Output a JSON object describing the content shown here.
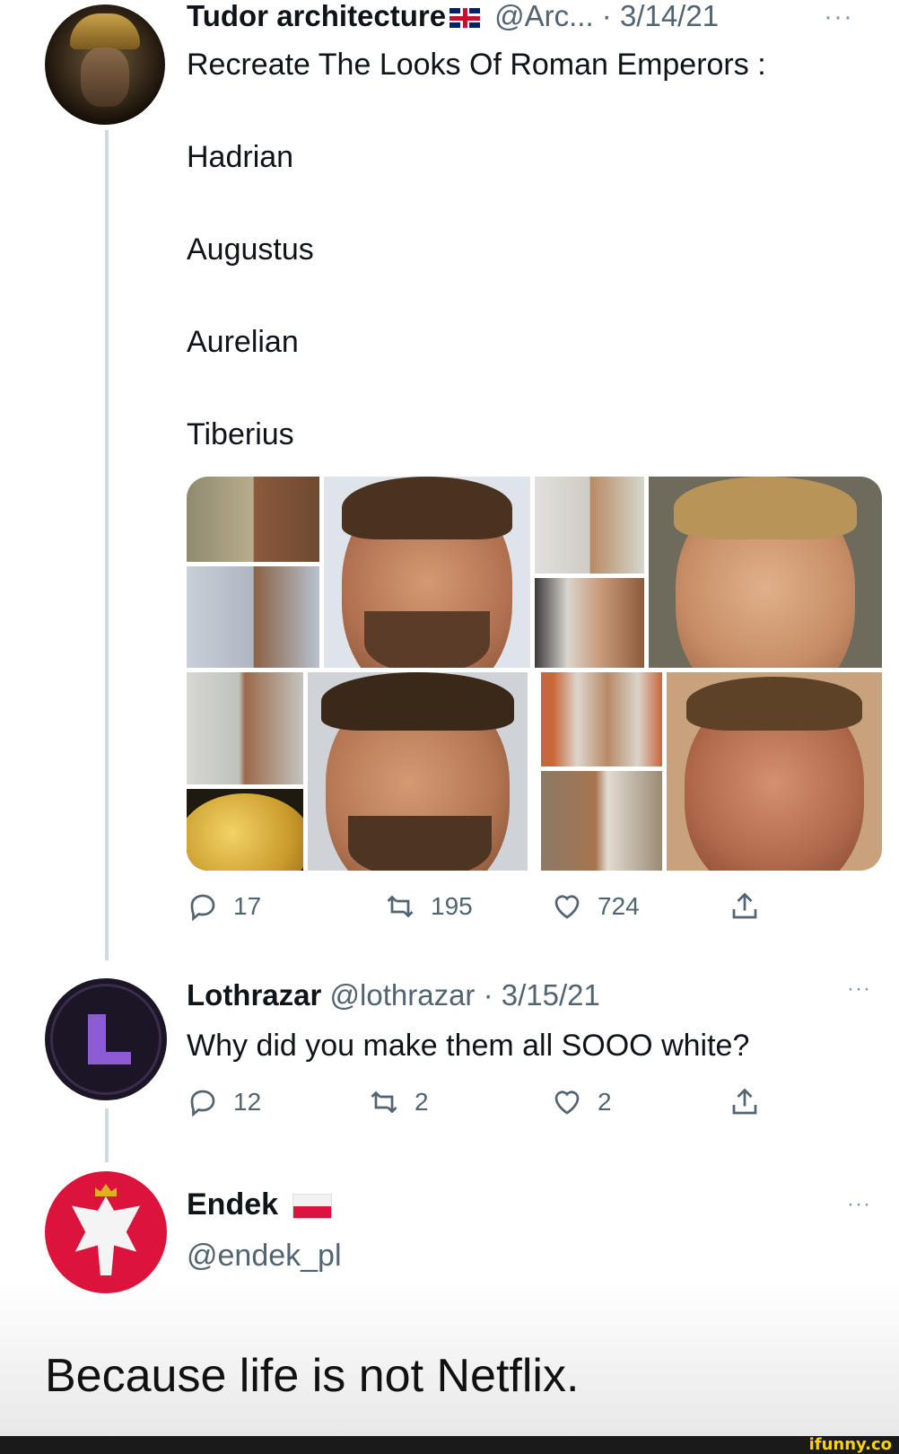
{
  "tweet1": {
    "display_name": "Tudor architecture",
    "flag": "🇬🇧",
    "handle_date": "@Arc... · 3/14/21",
    "more": "···",
    "text": "Recreate The Looks Of Roman Emperors :",
    "lines": [
      "Hadrian",
      "Augustus",
      "Aurelian",
      "Tiberius"
    ],
    "reply_count": "17",
    "retweet_count": "195",
    "like_count": "724"
  },
  "tweet2": {
    "display_name": "Lothrazar",
    "handle_date": "@lothrazar · 3/15/21",
    "more": "···",
    "text": "Why did you make them all SOOO white?",
    "reply_count": "12",
    "retweet_count": "2",
    "like_count": "2"
  },
  "tweet3": {
    "display_name": "Endek",
    "handle": "@endek_pl",
    "more": "···"
  },
  "caption": "Because life is not Netflix.",
  "watermark": "ifunny.co",
  "icons": {
    "reply": "reply-icon",
    "retweet": "retweet-icon",
    "like": "heart-icon",
    "share": "share-icon"
  },
  "colors": {
    "muted": "#536471",
    "thread_line": "#cfd9de",
    "avatar_l_bg": "#1b1525",
    "avatar_l_accent": "#8e5bd6",
    "poland_red": "#dc143c",
    "ifunny_yellow": "#ffd400"
  }
}
